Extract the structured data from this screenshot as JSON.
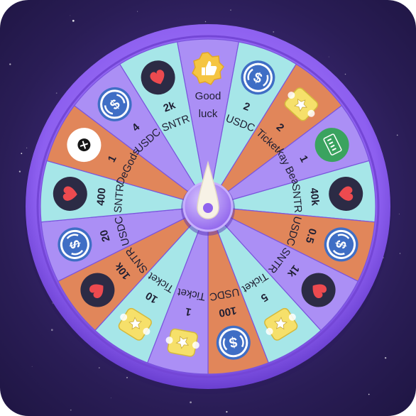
{
  "colors": {
    "background": "#35266b",
    "rim_outer": "#8d5ff0",
    "rim_inner": "#a67ff6",
    "cyan": "#a6e6e8",
    "orange": "#e1865a",
    "purple": "#ab8ff5",
    "token_blue": "#3f6ec5",
    "token_dark": "#2c2b45",
    "heart_red": "#ec4a4f",
    "ticket_yellow": "#f6e06a"
  },
  "pointer": {
    "icon": "spin-pointer-icon",
    "color": "#f7f2e6"
  },
  "segments": [
    {
      "value": "",
      "label": "Good luck",
      "lines": [
        "Good",
        "luck"
      ],
      "icon": "thumbs-up-badge-icon",
      "color": "purple"
    },
    {
      "value": "2",
      "label": "USDC",
      "icon": "usdc-icon",
      "color": "cyan"
    },
    {
      "value": "2",
      "label": "Ticket",
      "icon": "ticket-icon",
      "color": "orange"
    },
    {
      "value": "1",
      "label": "kay Bea",
      "icon": "okay-bears-icon",
      "color": "purple"
    },
    {
      "value": "40k",
      "label": "SNTR",
      "icon": "sntr-heart-icon",
      "color": "cyan"
    },
    {
      "value": "0.5",
      "label": "USDC",
      "icon": "usdc-icon",
      "color": "orange"
    },
    {
      "value": "1k",
      "label": "SNTR",
      "icon": "sntr-heart-icon",
      "color": "purple"
    },
    {
      "value": "5",
      "label": "Ticket",
      "icon": "ticket-icon",
      "color": "cyan"
    },
    {
      "value": "100",
      "label": "USDC",
      "icon": "usdc-icon",
      "color": "orange"
    },
    {
      "value": "1",
      "label": "Ticket",
      "icon": "ticket-icon",
      "color": "purple"
    },
    {
      "value": "10",
      "label": "Ticket",
      "icon": "ticket-icon",
      "color": "cyan"
    },
    {
      "value": "10k",
      "label": "SNTR",
      "icon": "sntr-heart-icon",
      "color": "orange"
    },
    {
      "value": "20",
      "label": "USDC",
      "icon": "usdc-icon",
      "color": "purple"
    },
    {
      "value": "400",
      "label": "SNTR",
      "icon": "sntr-heart-icon",
      "color": "cyan"
    },
    {
      "value": "1",
      "label": "DeGods",
      "icon": "degods-icon",
      "color": "orange"
    },
    {
      "value": "4",
      "label": "USDC",
      "icon": "usdc-icon",
      "color": "purple"
    },
    {
      "value": "2k",
      "label": "SNTR",
      "icon": "sntr-heart-icon",
      "color": "cyan"
    }
  ]
}
